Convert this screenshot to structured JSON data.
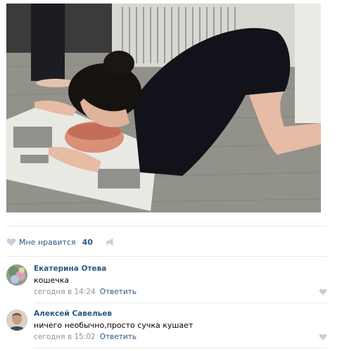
{
  "post": {
    "photo_alt": "post-photo",
    "likes": {
      "label": "Мне нравится",
      "count": "40"
    }
  },
  "comments": [
    {
      "author": "Екатерина Отева",
      "text": "кошечка",
      "date": "сегодня в 14:24",
      "reply_label": "Ответить"
    },
    {
      "author": "Алексей Савельев",
      "text": "ничего необычно,просто сучка кушает",
      "date": "сегодня в 15:02",
      "reply_label": "Ответить"
    }
  ],
  "colors": {
    "link": "#2a5885",
    "meta": "#939393",
    "icon": "#c5d0db",
    "divider": "#e7e8ec"
  },
  "icons": {
    "like": "heart-icon",
    "share": "megaphone-icon",
    "comment_like": "heart-icon"
  }
}
